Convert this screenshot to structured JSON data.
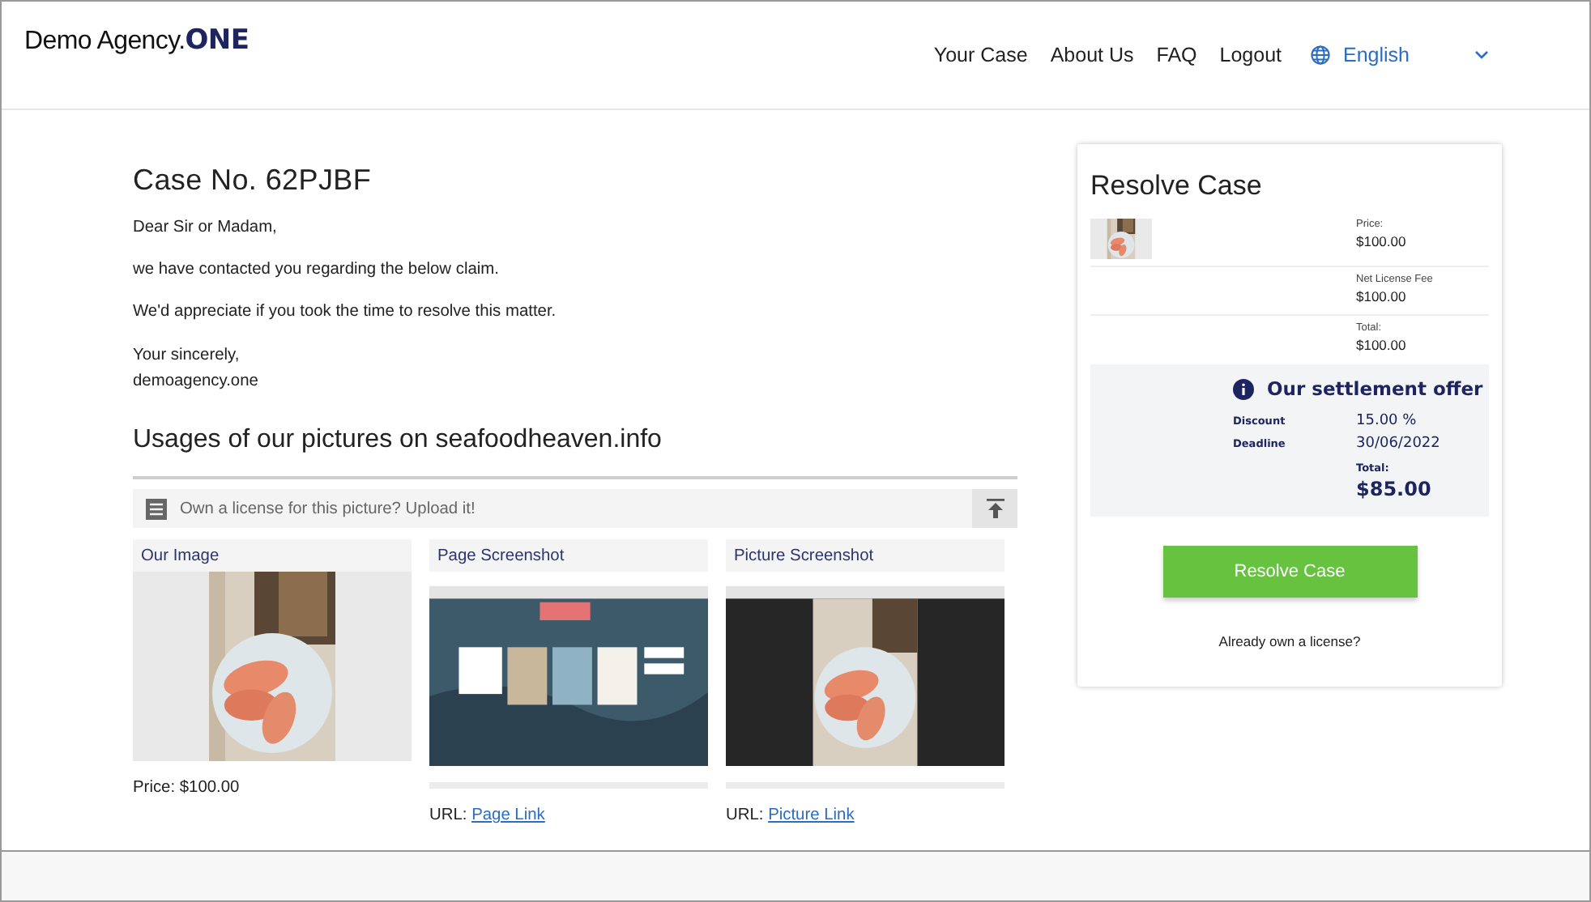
{
  "header": {
    "logo": "Demo Agency.**ONE**",
    "nav": [
      {
        "label": "Your Case"
      },
      {
        "label": "About Us"
      },
      {
        "label": "FAQ"
      },
      {
        "label": "Logout"
      }
    ],
    "language": {
      "label": "English"
    }
  },
  "case": {
    "title": "Case No. 62PJBF",
    "paragraphs": [
      "Dear Sir or Madam,",
      "we have contacted you regarding the below claim.",
      "We'd appreciate if you took the time to resolve this matter."
    ],
    "closing": [
      "Your sincerely,",
      "demoagency.one"
    ]
  },
  "usages": {
    "title": "Usages of our pictures on seafoodheaven.info",
    "upload_hint": "Own a license for this picture? Upload it!",
    "cards": [
      {
        "title": "Our Image",
        "price": "Price: $100.00"
      },
      {
        "kind": "page",
        "title": "Page Screenshot",
        "url_label": "URL:",
        "link": "Page Link"
      },
      {
        "kind": "picture",
        "title": "Picture Screenshot",
        "url_label": "URL:",
        "link": "Picture Link"
      }
    ]
  },
  "resolve": {
    "title": "Resolve Case",
    "lines": [
      {
        "label": "Price:",
        "value": "$100.00"
      },
      {
        "label": "Net License Fee",
        "value": "$100.00"
      },
      {
        "label": "Total:",
        "value": "$100.00"
      }
    ],
    "offer": {
      "title": "Our settlement offer",
      "rows": [
        {
          "label": "Discount",
          "value": "15.00 %"
        },
        {
          "label": "Deadline",
          "value": "30/06/2022"
        }
      ],
      "total_label": "Total:",
      "total": "$85.00"
    },
    "button": "Resolve Case",
    "license_link": "Already own a license?"
  }
}
